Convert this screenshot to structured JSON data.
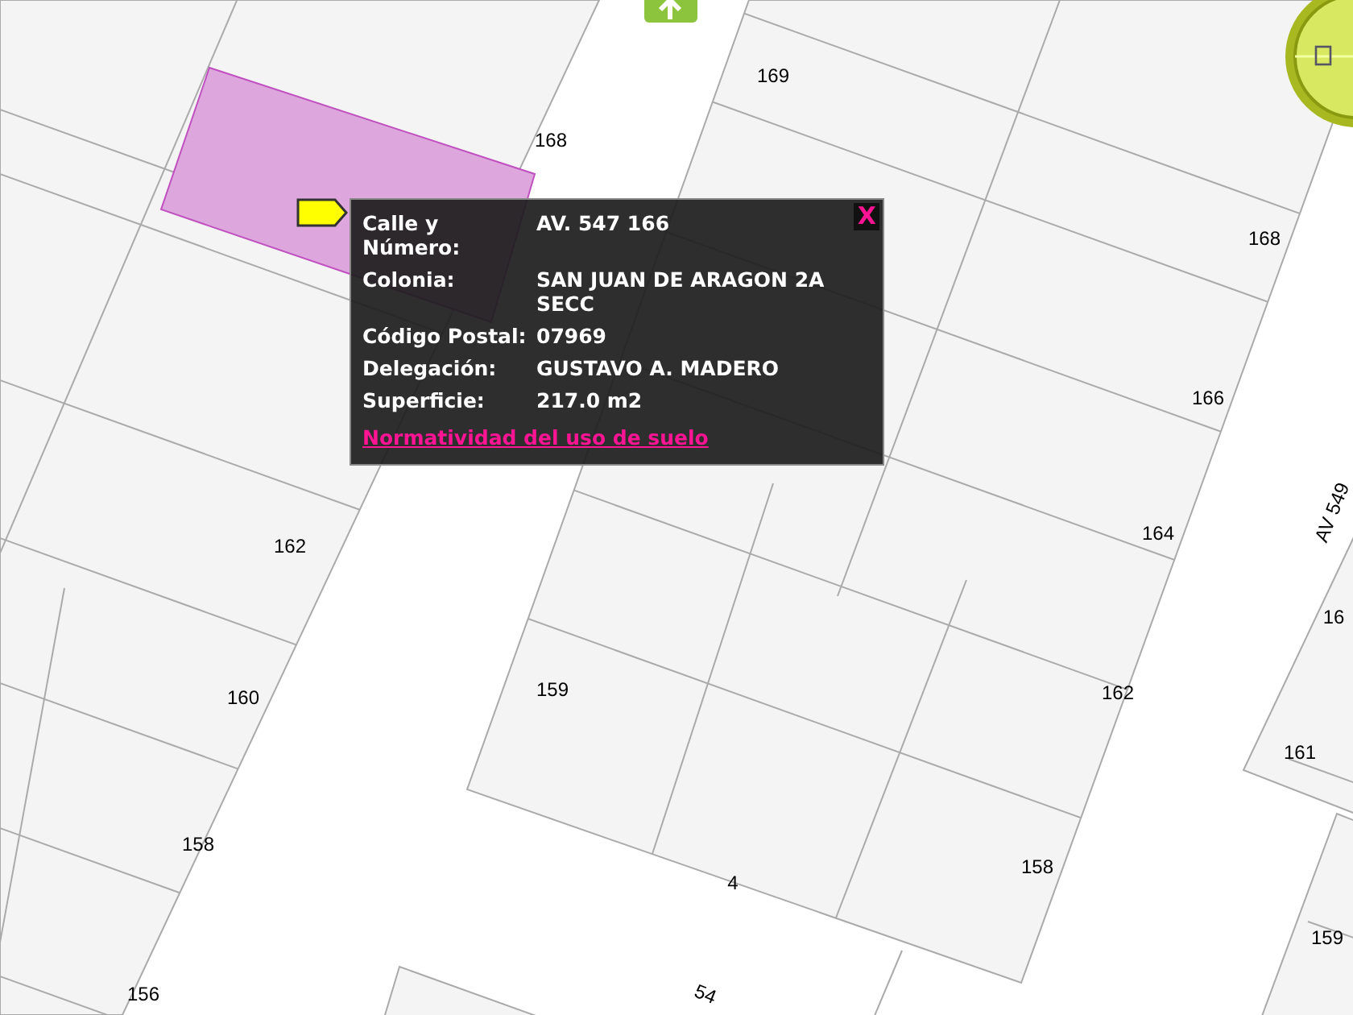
{
  "map": {
    "labels": [
      {
        "text": "169"
      },
      {
        "text": "168"
      },
      {
        "text": "168"
      },
      {
        "text": "166"
      },
      {
        "text": "162"
      },
      {
        "text": "164"
      },
      {
        "text": "AV 549"
      },
      {
        "text": "16"
      },
      {
        "text": "160"
      },
      {
        "text": "159"
      },
      {
        "text": "162"
      },
      {
        "text": "161"
      },
      {
        "text": "158"
      },
      {
        "text": "4"
      },
      {
        "text": "158"
      },
      {
        "text": "159"
      },
      {
        "text": "156"
      },
      {
        "text": "54"
      }
    ]
  },
  "popup": {
    "close": "X",
    "fields": [
      {
        "label": "Calle y Número:",
        "value": "AV. 547 166"
      },
      {
        "label": "Colonia:",
        "value": "SAN JUAN DE ARAGON 2A SECC"
      },
      {
        "label": "Código Postal:",
        "value": "07969"
      },
      {
        "label": "Delegación:",
        "value": "GUSTAVO A. MADERO"
      },
      {
        "label": "Superficie:",
        "value": "217.0 m2"
      }
    ],
    "link": "Normatividad del uso de suelo"
  }
}
